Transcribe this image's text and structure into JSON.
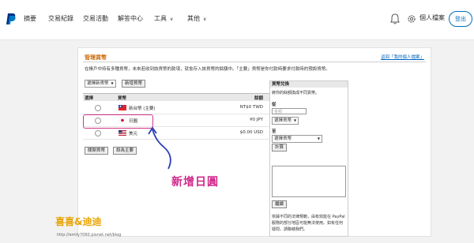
{
  "nav": {
    "items": [
      "摘要",
      "交易紀錄",
      "交易活動",
      "解答中心",
      "工具",
      "其他"
    ],
    "tools_label": "工具",
    "more_label": "其他",
    "profile_label": "個人檔案",
    "logout_label": "登出"
  },
  "page": {
    "title": "管理貨幣",
    "back_link": "返回「我的個人檔案」",
    "description": "在帳戶中持有多種貨幣，未來若收到該貨幣的款項，就會存入該貨幣的餘額中。「主要」貨幣是你付款時要求付款時的預設貨幣。",
    "select_default": "選擇新貨幣",
    "add_button": "新增貨幣",
    "table_headers": [
      "選擇",
      "貨幣",
      "餘額"
    ],
    "rows": [
      {
        "name": "新台幣 (主要)",
        "balance": "NT$0 TWD",
        "flag": "tw"
      },
      {
        "name": "日圓",
        "balance": "¥0 JPY",
        "flag": "jp"
      },
      {
        "name": "美元",
        "balance": "$0.00 USD",
        "flag": "us"
      }
    ],
    "close_button": "關閉貨幣",
    "make_primary_button": "設為主要"
  },
  "converter": {
    "title": "貨幣兌換",
    "intro": "將你的餘額換成不同貨幣。",
    "from_label": "從",
    "amount_placeholder": "金額",
    "from_select": "選擇貨幣",
    "to_label": "至",
    "to_select": "選擇貨幣",
    "calc_button": "計算",
    "continue_button": "繼續",
    "footer": "依據不同的法律規範，由有效能在 PayPal 服務的部分地區可能無法使用。如有任何疑問，請聯絡我們。"
  },
  "annotation": {
    "label": "新增日圓",
    "color": "#d1278a"
  },
  "watermark": {
    "text": "喜喜&迪迪",
    "url": "http://emily7060.pixnet.net/blog"
  }
}
